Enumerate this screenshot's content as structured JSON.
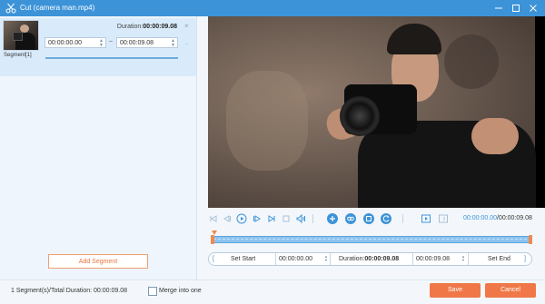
{
  "window": {
    "title": "Cut (camera man.mp4)"
  },
  "segment": {
    "duration_label": "Duration:",
    "duration_value": "00:00:09.08",
    "start_time": "00:00:00.00",
    "end_time": "00:00:09.08",
    "separator": "~",
    "label": "Segment[1]"
  },
  "left_panel": {
    "add_segment_label": "Add Segment"
  },
  "player": {
    "current_time": "00:00:00.00",
    "total_time": "/00:00:09.08"
  },
  "trim_bar": {
    "set_start_label": "Set Start",
    "start_time": "00:00:00.00",
    "duration_label": "Duration:",
    "duration_value": "00:00:09.08",
    "end_time": "00:00:09.08",
    "set_end_label": "Set End"
  },
  "footer": {
    "summary": "1 Segment(s)/Total Duration: 00:00:09.08",
    "merge_label": "Merge into one",
    "merge_checked": false,
    "save_label": "Save",
    "cancel_label": "Cancel"
  },
  "colors": {
    "titlebar": "#3d93d8",
    "accent": "#3d93d8",
    "orange": "#f07848",
    "track": "#8ec3ef"
  },
  "icons": [
    "scissors-icon",
    "minimize-icon",
    "maximize-icon",
    "close-icon",
    "skip-start-icon",
    "prev-frame-icon",
    "play-icon",
    "next-frame-icon",
    "skip-end-icon",
    "stop-icon",
    "volume-icon",
    "add-icon",
    "copy-icon",
    "duplicate-icon",
    "reset-icon",
    "set-start-marker-icon",
    "set-end-marker-icon"
  ]
}
